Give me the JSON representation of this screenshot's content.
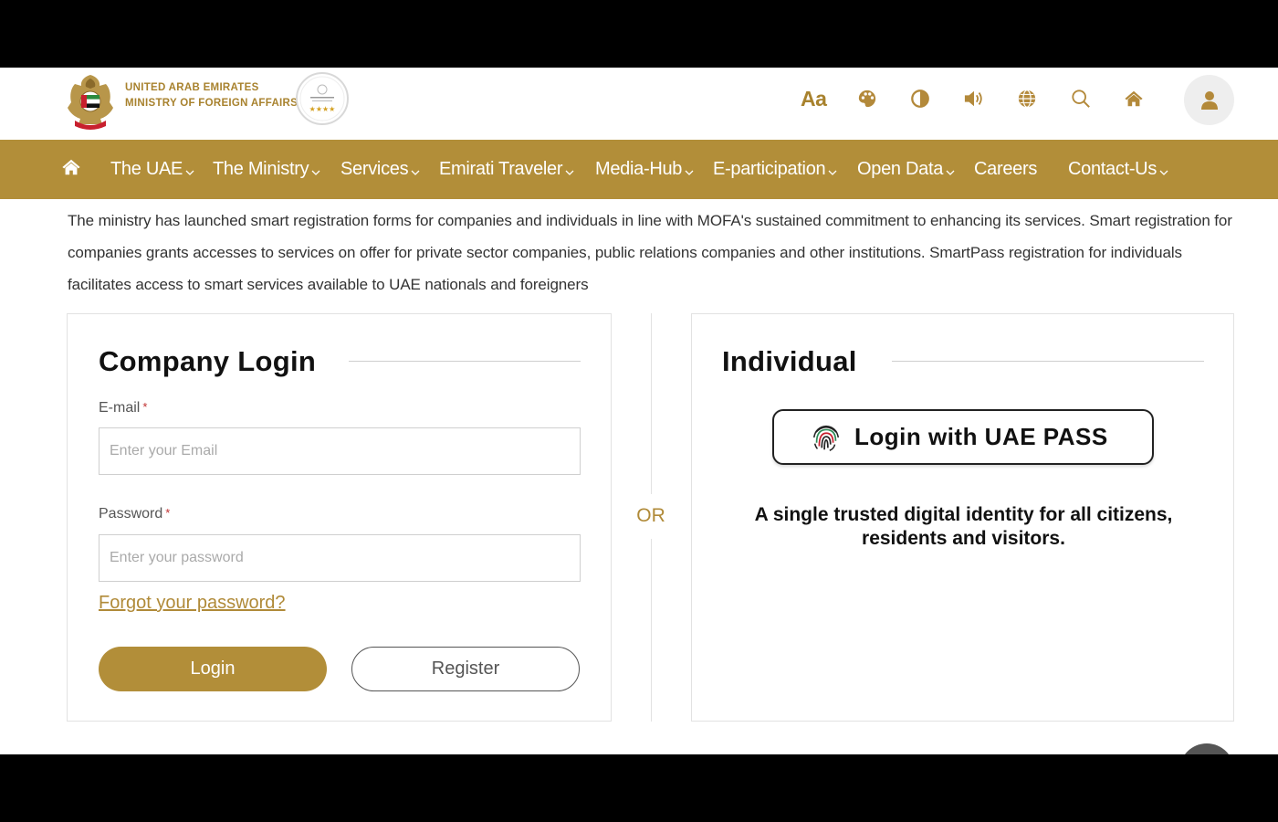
{
  "header": {
    "org_line1": "UNITED ARAB EMIRATES",
    "org_line2": "MINISTRY OF FOREIGN AFFAIRS",
    "tools": [
      {
        "icon": "font-size-icon",
        "label": "Aa"
      },
      {
        "icon": "palette-icon"
      },
      {
        "icon": "contrast-icon"
      },
      {
        "icon": "speaker-icon"
      },
      {
        "icon": "globe-icon"
      },
      {
        "icon": "search-icon"
      },
      {
        "icon": "home-icon"
      }
    ],
    "accent_color": "#b28e39"
  },
  "nav": {
    "items": [
      {
        "label": "The UAE",
        "has_menu": true
      },
      {
        "label": "The Ministry",
        "has_menu": true
      },
      {
        "label": "Services",
        "has_menu": true
      },
      {
        "label": "Emirati Traveler",
        "has_menu": true
      },
      {
        "label": "Media-Hub",
        "has_menu": true
      },
      {
        "label": "E-participation",
        "has_menu": true
      },
      {
        "label": "Open Data",
        "has_menu": true
      },
      {
        "label": "Careers",
        "has_menu": false
      },
      {
        "label": "Contact-Us",
        "has_menu": true
      }
    ]
  },
  "intro": {
    "text": "The ministry has launched smart registration forms for companies and individuals in line with MOFA's sustained commitment to enhancing its services. Smart registration for companies grants accesses to services on offer for private sector companies, public relations companies and other institutions. SmartPass registration for individuals facilitates access to smart services available to UAE nationals and foreigners"
  },
  "company_login": {
    "title": "Company Login",
    "email_label": "E-mail",
    "email_placeholder": "Enter your Email",
    "email_value": "",
    "password_label": "Password",
    "password_placeholder": "Enter your password",
    "password_value": "",
    "required_mark": "*",
    "forgot_link": "Forgot your password?",
    "login_button": "Login",
    "register_button": "Register"
  },
  "divider": {
    "or_label": "OR"
  },
  "individual": {
    "title": "Individual",
    "uaepass_button": "Login with UAE PASS",
    "description": "A single trusted digital identity for all citizens, residents and visitors."
  }
}
